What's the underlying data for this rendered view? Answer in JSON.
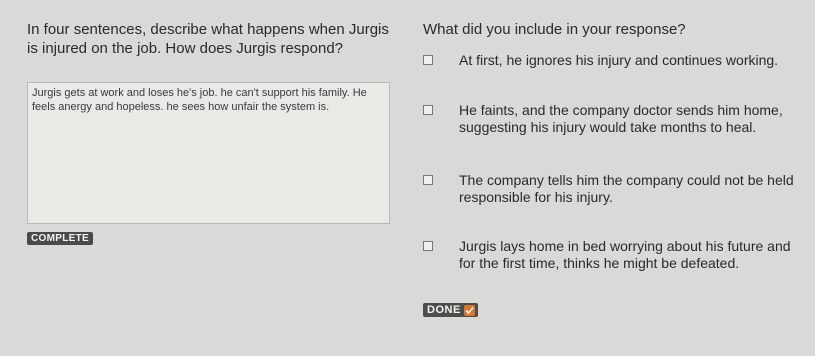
{
  "left": {
    "prompt": "In four sentences, describe what happens when Jurgis is injured on the job. How does Jurgis respond?",
    "essay_text": "Jurgis gets at work and loses he's job. he can't support his family. He feels anergy and hopeless. he sees how unfair the system is.",
    "status_label": "COMPLETE"
  },
  "right": {
    "question": "What did you include in your response?",
    "options": [
      {
        "text": "At first, he ignores his injury and continues working."
      },
      {
        "text": "He faints, and the company doctor sends him home, suggesting his injury would take months to heal."
      },
      {
        "text": "The company tells him the company could not be held responsible for his injury."
      },
      {
        "text": "Jurgis lays home in bed worrying about his future and for the first time, thinks he might be defeated."
      }
    ],
    "done_label": "DONE"
  },
  "colors": {
    "background": "#d9d9d7",
    "essay_box": "#e9e9e6",
    "badge": "#4a4a48",
    "accent_check": "#e0742b"
  },
  "icons": {
    "done": "checkmark-icon",
    "option": "checkbox"
  }
}
